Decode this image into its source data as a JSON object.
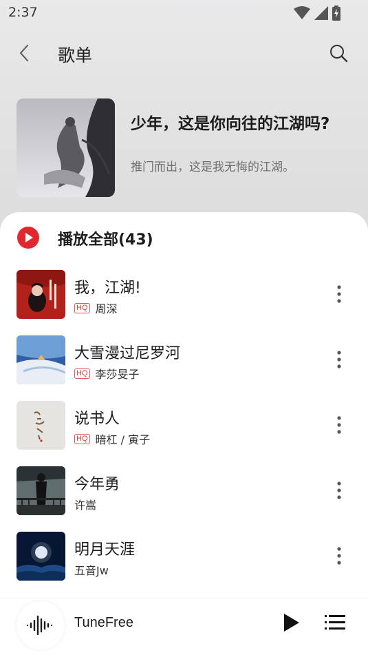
{
  "status": {
    "time": "2:37"
  },
  "header": {
    "title": "歌单"
  },
  "playlist": {
    "name": "少年，这是你向往的江湖吗?",
    "description": "推门而出，这是我无悔的江湖。"
  },
  "play_all": {
    "label": "播放全部(43)"
  },
  "songs": [
    {
      "title": "我，江湖!",
      "artist": "周深",
      "hq": "HQ"
    },
    {
      "title": "大雪漫过尼罗河",
      "artist": "李莎旻子",
      "hq": "HQ"
    },
    {
      "title": "说书人",
      "artist": "暗杠 / 寅子",
      "hq": "HQ"
    },
    {
      "title": "今年勇",
      "artist": "许嵩",
      "hq": ""
    },
    {
      "title": "明月天涯",
      "artist": "五音Jw",
      "hq": ""
    }
  ],
  "player": {
    "title": "TuneFree"
  },
  "colors": {
    "accent": "#e0282e",
    "hq": "#e03a3a"
  }
}
